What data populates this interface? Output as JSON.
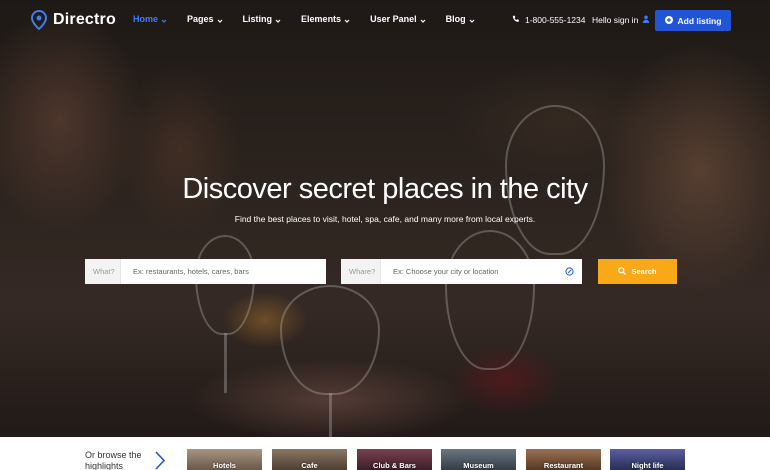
{
  "brand": {
    "name": "Directro",
    "accent": "#3f7bf5"
  },
  "nav": {
    "items": [
      {
        "label": "Home",
        "active": true
      },
      {
        "label": "Pages",
        "active": false
      },
      {
        "label": "Listing",
        "active": false
      },
      {
        "label": "Elements",
        "active": false
      },
      {
        "label": "User Panel",
        "active": false
      },
      {
        "label": "Blog",
        "active": false
      }
    ],
    "phone": "1-800-555-1234",
    "signin": "Hello sign in",
    "add_listing": "Add listing",
    "add_button_color": "#2155d6"
  },
  "hero": {
    "headline": "Discover secret places in the city",
    "subline": "Find the best places to visit, hotel, spa, cafe, and many more from local experts."
  },
  "search": {
    "what_label": "What?",
    "what_placeholder": "Ex: restaurants, hotels, cares, bars",
    "where_label": "Whare?",
    "where_placeholder": "Ex: Choose your city or location",
    "button_label": "Search",
    "button_color": "#f9a918"
  },
  "browse": {
    "text": "Or browse the highlights",
    "categories": [
      {
        "label": "Hotels",
        "color": "#8a7560"
      },
      {
        "label": "Cafe",
        "color": "#6e5a48"
      },
      {
        "label": "Club & Bars",
        "color": "#5a2f3a"
      },
      {
        "label": "Museum",
        "color": "#4a5560"
      },
      {
        "label": "Restaurant",
        "color": "#7a5238"
      },
      {
        "label": "Night life",
        "color": "#3a3f70"
      }
    ]
  }
}
